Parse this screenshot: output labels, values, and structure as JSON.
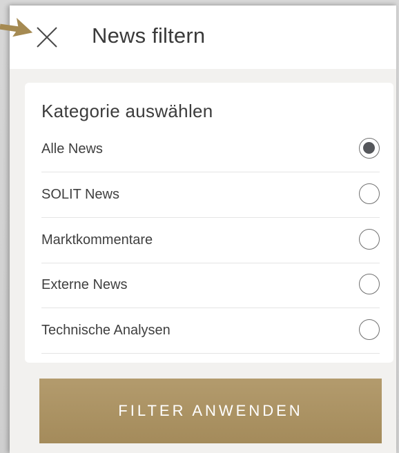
{
  "header": {
    "title": "News filtern",
    "close_icon": "close-icon"
  },
  "filter": {
    "title": "Kategorie auswählen",
    "options": [
      {
        "label": "Alle News",
        "selected": true
      },
      {
        "label": "SOLIT News",
        "selected": false
      },
      {
        "label": "Marktkommentare",
        "selected": false
      },
      {
        "label": "Externe News",
        "selected": false
      },
      {
        "label": "Technische Analysen",
        "selected": false
      }
    ]
  },
  "actions": {
    "apply_label": "FILTER ANWENDEN"
  },
  "colors": {
    "accent": "#ab9262",
    "pointer": "#a58a52",
    "radio_fill": "#55575b"
  }
}
